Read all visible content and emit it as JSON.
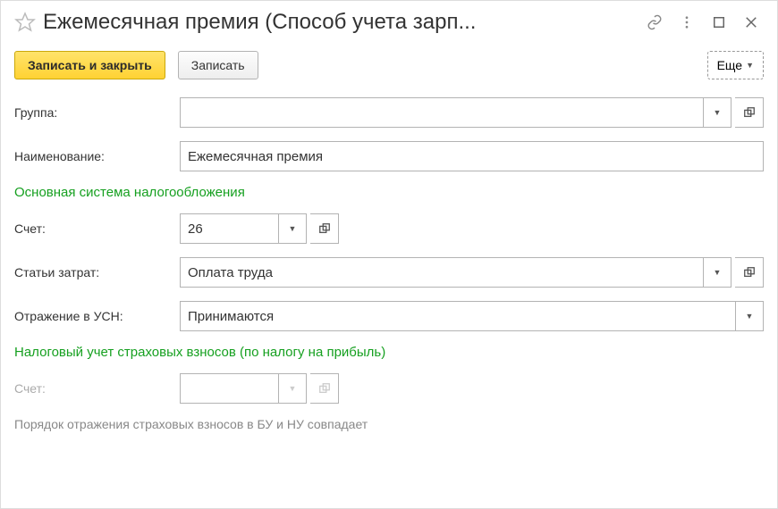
{
  "header": {
    "title": "Ежемесячная премия (Способ учета зарп..."
  },
  "toolbar": {
    "save_close": "Записать и закрыть",
    "save": "Записать",
    "more": "Еще"
  },
  "fields": {
    "group": {
      "label": "Группа:",
      "value": ""
    },
    "name": {
      "label": "Наименование:",
      "value": "Ежемесячная премия"
    },
    "section_main": "Основная система налогообложения",
    "account": {
      "label": "Счет:",
      "value": "26"
    },
    "cost_item": {
      "label": "Статьи затрат:",
      "value": "Оплата труда"
    },
    "usn": {
      "label": "Отражение в УСН:",
      "value": "Принимаются"
    },
    "section_tax": "Налоговый учет страховых взносов (по налогу на прибыль)",
    "account2": {
      "label": "Счет:",
      "value": ""
    },
    "info": "Порядок отражения страховых взносов в БУ и НУ совпадает"
  }
}
